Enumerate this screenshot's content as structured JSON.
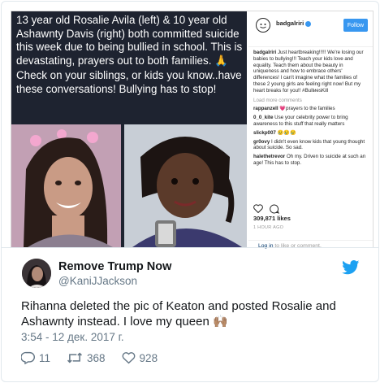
{
  "instagram": {
    "caption_line1": "13 year old Rosalie Avila (left) & 10 year old Ashawnty Davis (right) both committed suicide this week due to being bullied in school. This is devastating, prayers out to both families. 🙏",
    "caption_line2": "Check on your siblings, or kids you know..have these conversations! Bullying has to stop!",
    "username": "badgalriri",
    "follow_label": "Follow",
    "post_text": "Just heartbreaking!!!!! We're losing our babies to bullying!!! Teach your kids love and equality. Teach them about the beauty in uniqueness and how to embrace others' differences! I can't imagine what the families of these 2 young girls are feeling right now! But my heart breaks for you!! #BullиesKill",
    "load_more": "Load more comments",
    "comments": [
      {
        "user": "rappanzell",
        "text": "💗prayers to the families"
      },
      {
        "user": "0_0_kite",
        "text": "Use your celebrity power to bring awareness to this stuff that really matters"
      },
      {
        "user": "slickp007",
        "text": "😢😢😢"
      },
      {
        "user": "gr0ovy",
        "text": "I didn't even know kids that young thought about suicide. So sad."
      },
      {
        "user": "halethetrevor",
        "text": "Oh my. Driven to suicide at such an age! This has to stop."
      }
    ],
    "likes": "309,871 likes",
    "time": "1 HOUR AGO",
    "login_link": "Log in",
    "login_rest": "to like or comment."
  },
  "tweet": {
    "name": "Remove Trump Now",
    "handle": "@KaniJJackson",
    "text": "Rihanna deleted the pic of Keaton and posted Rosalie and Ashawnty instead. I love my queen",
    "emoji": "🙌🏽",
    "date": "3:54 - 12 дек. 2017 г.",
    "replies": "11",
    "retweets": "368",
    "likes": "928"
  },
  "colors": {
    "twitter_blue": "#1da1f2",
    "instagram_blue": "#3897f0",
    "post_background": "#1e2330"
  },
  "icons": [
    "instagram-logo-icon",
    "verified-icon",
    "heart-icon",
    "comment-icon",
    "twitter-bird-icon",
    "reply-icon",
    "retweet-icon",
    "like-icon"
  ]
}
